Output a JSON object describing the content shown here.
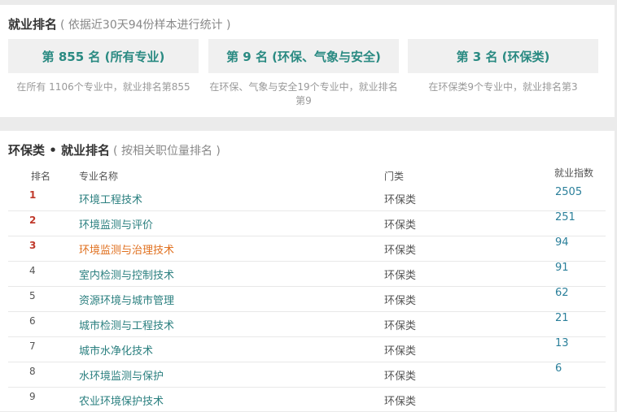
{
  "summary": {
    "title": "就业排名",
    "subtitle": "( 依据近30天94份样本进行统计 )",
    "boxes": [
      {
        "label": "第 855 名 (所有专业)",
        "desc": "在所有 1106个专业中，就业排名第855"
      },
      {
        "label": "第 9 名 (环保、气象与安全)",
        "desc": "在环保、气象与安全19个专业中，就业排名第9"
      },
      {
        "label": "第 3 名 (环保类)",
        "desc": "在环保类9个专业中，就业排名第3"
      }
    ]
  },
  "ranking": {
    "title": "环保类 • 就业排名",
    "subtitle": "( 按相关职位量排名 )",
    "headers": {
      "rank": "排名",
      "name": "专业名称",
      "category": "门类",
      "index": "就业指数"
    },
    "rows": [
      {
        "rank": "1",
        "name": "环境工程技术",
        "category": "环保类",
        "index": "2505"
      },
      {
        "rank": "2",
        "name": "环境监测与评价",
        "category": "环保类",
        "index": "251"
      },
      {
        "rank": "3",
        "name": "环境监测与治理技术",
        "category": "环保类",
        "index": "94"
      },
      {
        "rank": "4",
        "name": "室内检测与控制技术",
        "category": "环保类",
        "index": "91"
      },
      {
        "rank": "5",
        "name": "资源环境与城市管理",
        "category": "环保类",
        "index": "62"
      },
      {
        "rank": "6",
        "name": "城市检测与工程技术",
        "category": "环保类",
        "index": "21"
      },
      {
        "rank": "7",
        "name": "城市水净化技术",
        "category": "环保类",
        "index": "13"
      },
      {
        "rank": "8",
        "name": "水环境监测与保护",
        "category": "环保类",
        "index": "6"
      },
      {
        "rank": "9",
        "name": "农业环境保护技术",
        "category": "环保类",
        "index": ""
      }
    ]
  }
}
